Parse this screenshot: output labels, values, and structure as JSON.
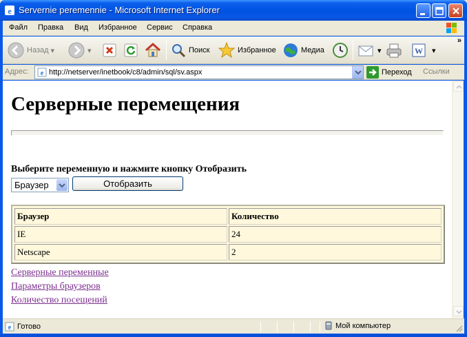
{
  "window": {
    "title": "Servernie peremennie - Microsoft Internet Explorer"
  },
  "menu": {
    "items": [
      "Файл",
      "Правка",
      "Вид",
      "Избранное",
      "Сервис",
      "Справка"
    ]
  },
  "toolbar": {
    "back": "Назад",
    "search": "Поиск",
    "favorites": "Избранное",
    "media": "Медиа"
  },
  "address": {
    "label": "Адрес:",
    "url": "http://netserver/inetbook/c8/admin/sql/sv.aspx",
    "go": "Переход",
    "links": "Ссылки"
  },
  "page": {
    "title": "Серверные перемещения",
    "prompt": "Выберите переменную и нажмите кнопку Отобразить",
    "select_value": "Браузер",
    "show_button": "Отобразить",
    "table": {
      "headers": [
        "Браузер",
        "Количество"
      ],
      "rows": [
        [
          "IE",
          "24"
        ],
        [
          "Netscape",
          "2"
        ]
      ]
    },
    "links": [
      "Серверные переменные",
      "Параметры браузеров",
      "Количество посещений"
    ]
  },
  "status": {
    "text": "Готово",
    "zone": "Мой компьютер"
  },
  "colors": {
    "titlebar": "#0A5FEB",
    "table_bg": "#FFF8DC",
    "link_visited": "#7B2F8E",
    "chrome": "#ECE9D8"
  }
}
